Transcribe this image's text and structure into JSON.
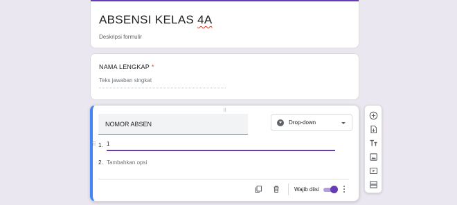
{
  "form": {
    "title_prefix": "ABSENSI KELAS ",
    "title_suffix": "4A",
    "description_placeholder": "Deskripsi formulir"
  },
  "question1": {
    "title": "NAMA LENGKAP",
    "required_star": "*",
    "answer_placeholder": "Teks jawaban singkat"
  },
  "question2": {
    "title": "NOMOR ABSEN",
    "type_label": "Drop-down",
    "options": [
      {
        "number": "1.",
        "text": "1"
      },
      {
        "number": "2.",
        "text": "Tambahkan opsi"
      }
    ],
    "required_label": "Wajib diisi",
    "required_on": true
  },
  "colors": {
    "accent": "#673ab7",
    "active_border": "#4285f4",
    "required": "#d93025"
  },
  "toolbar_icons": [
    "add-question-icon",
    "import-question-icon",
    "add-title-icon",
    "add-image-icon",
    "add-video-icon",
    "add-section-icon"
  ]
}
